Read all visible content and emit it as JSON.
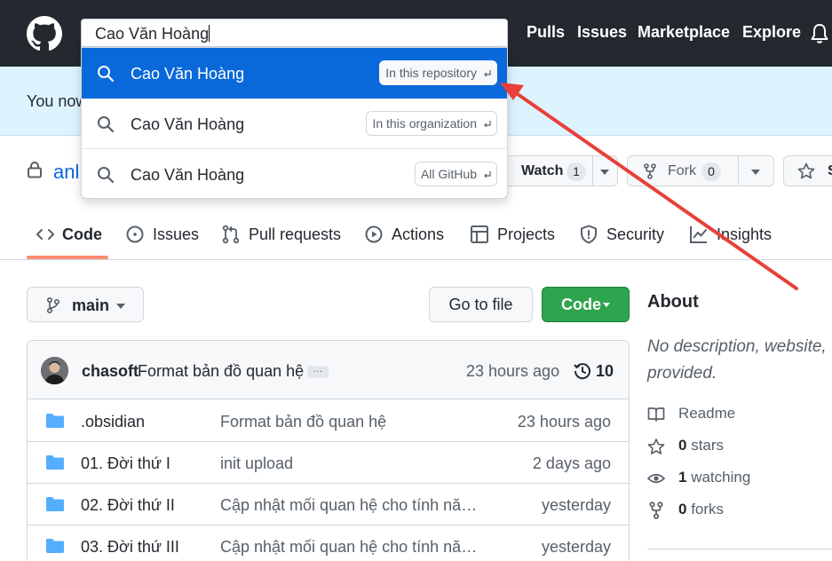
{
  "header": {
    "search_value": "Cao Văn Hoàng",
    "nav": [
      "Pulls",
      "Issues",
      "Marketplace",
      "Explore"
    ],
    "icons": {
      "logo": "github-mark-icon",
      "notifications": "bell-icon"
    }
  },
  "search_dropdown": {
    "items": [
      {
        "text": "Cao Văn Hoàng",
        "scope": "In this repository",
        "active": true
      },
      {
        "text": "Cao Văn Hoàng",
        "scope": "In this organization",
        "active": false
      },
      {
        "text": "Cao Văn Hoàng",
        "scope": "All GitHub",
        "active": false
      }
    ]
  },
  "banner": {
    "text": "You now"
  },
  "repo": {
    "owner_fragment": "anl",
    "watch": {
      "label": "Watch",
      "count": "1"
    },
    "fork": {
      "label": "Fork",
      "count": "0"
    },
    "star": {
      "label": "S"
    }
  },
  "tabs": [
    {
      "label": "Code",
      "icon": "code-icon",
      "selected": true
    },
    {
      "label": "Issues",
      "icon": "issue-icon"
    },
    {
      "label": "Pull requests",
      "icon": "pull-request-icon"
    },
    {
      "label": "Actions",
      "icon": "play-icon"
    },
    {
      "label": "Projects",
      "icon": "table-icon"
    },
    {
      "label": "Security",
      "icon": "shield-icon"
    },
    {
      "label": "Insights",
      "icon": "graph-icon"
    }
  ],
  "toolbar": {
    "branch": "main",
    "goto_file": "Go to file",
    "code_label": "Code"
  },
  "latest_commit": {
    "author": "chasoft",
    "message": "Format bản đồ quan hệ",
    "ellipsis": "…",
    "time": "23 hours ago",
    "commit_count": "10"
  },
  "files": [
    {
      "name": ".obsidian",
      "commit": "Format bản đồ quan hệ",
      "time": "23 hours ago"
    },
    {
      "name": "01. Đời thứ I",
      "commit": "init upload",
      "time": "2 days ago"
    },
    {
      "name": "02. Đời thứ II",
      "commit": "Cập nhật mối quan hệ cho tính năn...",
      "time": "yesterday"
    },
    {
      "name": "03. Đời thứ III",
      "commit": "Cập nhật mối quan hệ cho tính năn...",
      "time": "yesterday"
    }
  ],
  "about": {
    "title": "About",
    "description": "No description, website, provided.",
    "readme": "Readme",
    "stars_count": "0",
    "stars_label": "stars",
    "watching_count": "1",
    "watching_label": "watching",
    "forks_count": "0",
    "forks_label": "forks"
  },
  "colors": {
    "header_bg": "#24292f",
    "accent_blue": "#0969da",
    "code_button_green": "#2da44e",
    "annotation_red": "#e8403a",
    "banner_bg": "#ddf4ff"
  }
}
